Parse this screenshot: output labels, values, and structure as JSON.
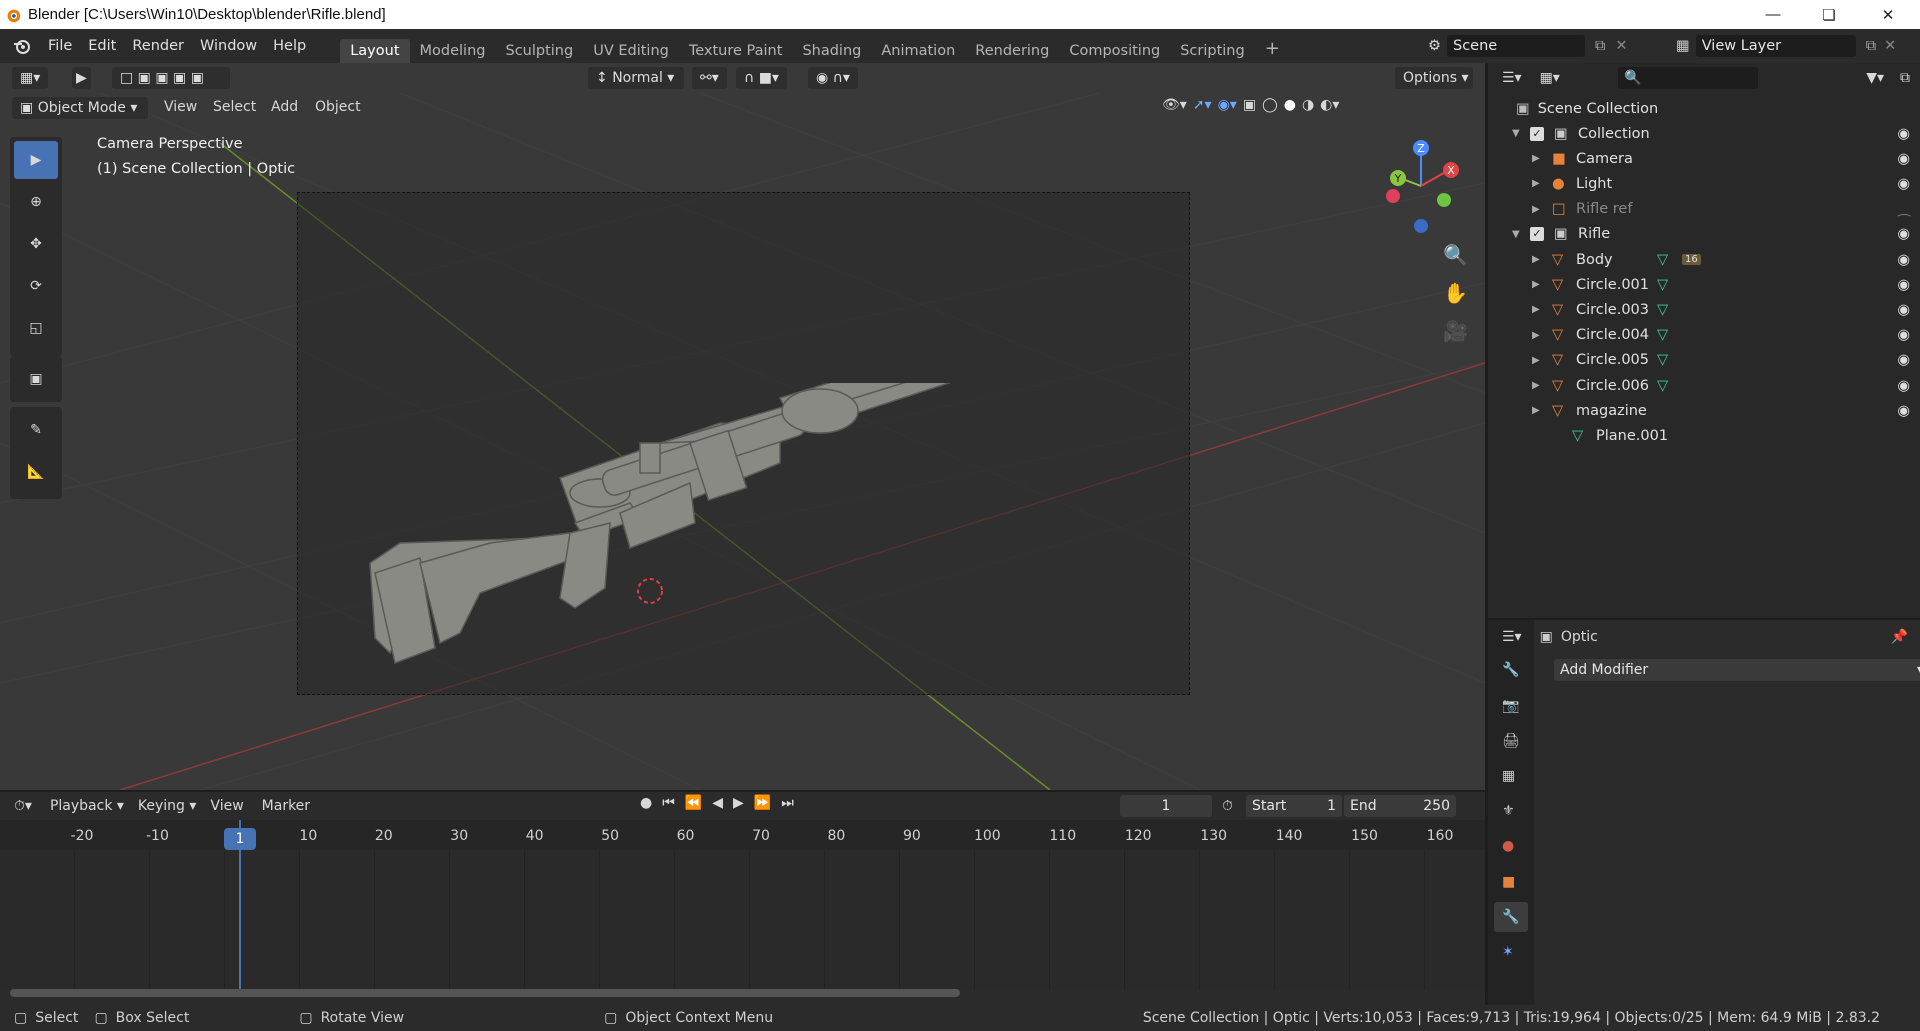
{
  "titlebar": {
    "title": "Blender [C:\\Users\\Win10\\Desktop\\blender\\Rifle.blend]"
  },
  "menu": [
    "File",
    "Edit",
    "Render",
    "Window",
    "Help"
  ],
  "workspaces": [
    "Layout",
    "Modeling",
    "Sculpting",
    "UV Editing",
    "Texture Paint",
    "Shading",
    "Animation",
    "Rendering",
    "Compositing",
    "Scripting"
  ],
  "scene": {
    "label": "Scene",
    "view_layer": "View Layer"
  },
  "viewport": {
    "mode": "Object Mode",
    "menu": [
      "View",
      "Select",
      "Add",
      "Object"
    ],
    "orientation": "Normal",
    "options": "Options",
    "overlay_title": "Camera Perspective",
    "overlay_sub": "(1) Scene Collection | Optic",
    "gizmo": {
      "z": "Z",
      "y": "Y",
      "x": "X"
    }
  },
  "outliner": {
    "root": "Scene Collection",
    "rows": [
      {
        "label": "Collection",
        "type": "collection"
      },
      {
        "label": "Camera",
        "type": "camera"
      },
      {
        "label": "Light",
        "type": "light"
      },
      {
        "label": "Rifle ref",
        "type": "image"
      },
      {
        "label": "Rifle",
        "type": "collection"
      },
      {
        "label": "Body",
        "type": "mesh",
        "badge": "16"
      },
      {
        "label": "Circle.001",
        "type": "mesh"
      },
      {
        "label": "Circle.003",
        "type": "mesh"
      },
      {
        "label": "Circle.004",
        "type": "mesh"
      },
      {
        "label": "Circle.005",
        "type": "mesh"
      },
      {
        "label": "Circle.006",
        "type": "mesh"
      },
      {
        "label": "magazine",
        "type": "mesh"
      },
      {
        "label": "Plane.001",
        "type": "meshdata"
      }
    ]
  },
  "properties": {
    "object": "Optic",
    "add_modifier": "Add Modifier"
  },
  "timeline": {
    "menu": [
      "Playback",
      "Keying",
      "View",
      "Marker"
    ],
    "current_frame": "1",
    "start_label": "Start",
    "start": "1",
    "end_label": "End",
    "end": "250",
    "ticks": [
      "-20",
      "-10",
      "1",
      "10",
      "20",
      "30",
      "40",
      "50",
      "60",
      "70",
      "80",
      "90",
      "100",
      "110",
      "120",
      "130",
      "140",
      "150",
      "160"
    ]
  },
  "status": {
    "select": "Select",
    "box_select": "Box Select",
    "rotate_view": "Rotate View",
    "context_menu": "Object Context Menu",
    "info": "Scene Collection | Optic | Verts:10,053 | Faces:9,713 | Tris:19,964 | Objects:0/25 | Mem: 64.9 MiB | 2.83.2"
  },
  "colors": {
    "accent": "#4772b3",
    "mesh": "#e8813a",
    "data": "#3ec9a0"
  }
}
